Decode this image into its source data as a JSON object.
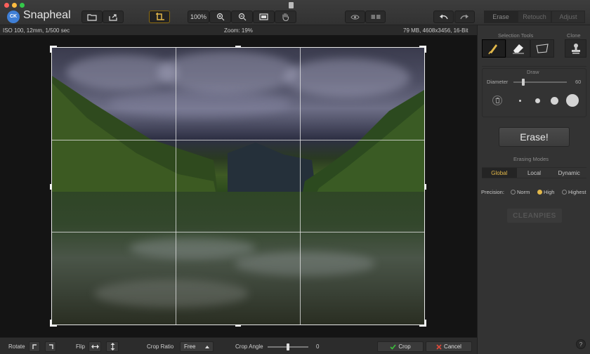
{
  "app": {
    "name": "Snapheal",
    "logo_text": "CK"
  },
  "toolbar": {
    "zoom_label": "100%",
    "mode_tabs": [
      "Erase",
      "Retouch",
      "Adjust"
    ]
  },
  "infobar": {
    "camera": "ISO 100, 12mm, 1/500 sec",
    "zoom": "Zoom: 19%",
    "file": "79 MB, 4608x3456, 16-Bit"
  },
  "bottombar": {
    "rotate_label": "Rotate",
    "flip_label": "Flip",
    "crop_ratio_label": "Crop Ratio",
    "crop_ratio_value": "Free",
    "crop_angle_label": "Crop Angle",
    "crop_angle_value": "0",
    "crop_button": "Crop",
    "cancel_button": "Cancel"
  },
  "panel": {
    "selection_tools_label": "Selection Tools",
    "clone_label": "Clone",
    "draw_label": "Draw",
    "diameter_label": "Diameter",
    "diameter_value": "60",
    "erase_button": "Erase!",
    "erasing_modes_label": "Erasing Modes",
    "erasing_modes": [
      "Global",
      "Local",
      "Dynamic"
    ],
    "precision_label": "Precision:",
    "precision_options": [
      "Norm",
      "High",
      "Highest"
    ],
    "precision_selected": "High",
    "watermark": "CLEANPIES"
  },
  "colors": {
    "accent": "#e2b84a",
    "crop_confirm": "#3cbf3c",
    "cancel": "#e04a3a"
  }
}
